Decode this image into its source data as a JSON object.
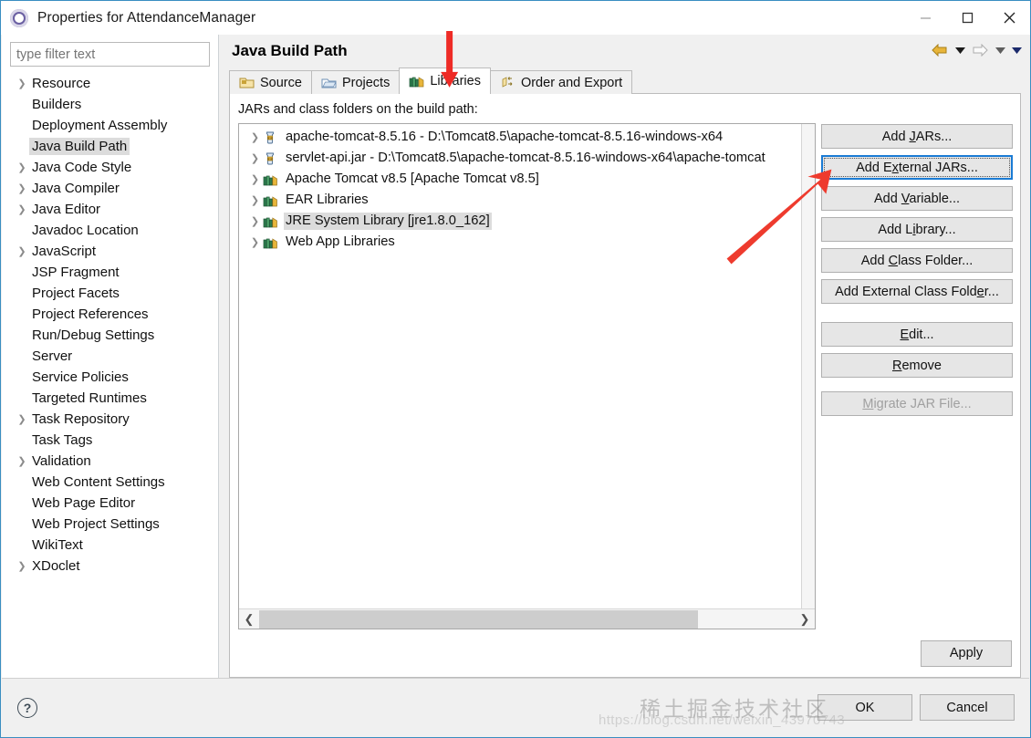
{
  "window": {
    "title": "Properties for AttendanceManager",
    "icon": "eclipse-properties-icon",
    "controls": {
      "minimize": "–",
      "maximize": "□",
      "close": "✕"
    }
  },
  "sidebar": {
    "filter": {
      "placeholder": "type filter text",
      "value": ""
    },
    "items": [
      {
        "label": "Resource",
        "expandable": true,
        "selected": false
      },
      {
        "label": "Builders",
        "expandable": false,
        "selected": false
      },
      {
        "label": "Deployment Assembly",
        "expandable": false,
        "selected": false
      },
      {
        "label": "Java Build Path",
        "expandable": false,
        "selected": true
      },
      {
        "label": "Java Code Style",
        "expandable": true,
        "selected": false
      },
      {
        "label": "Java Compiler",
        "expandable": true,
        "selected": false
      },
      {
        "label": "Java Editor",
        "expandable": true,
        "selected": false
      },
      {
        "label": "Javadoc Location",
        "expandable": false,
        "selected": false
      },
      {
        "label": "JavaScript",
        "expandable": true,
        "selected": false
      },
      {
        "label": "JSP Fragment",
        "expandable": false,
        "selected": false
      },
      {
        "label": "Project Facets",
        "expandable": false,
        "selected": false
      },
      {
        "label": "Project References",
        "expandable": false,
        "selected": false
      },
      {
        "label": "Run/Debug Settings",
        "expandable": false,
        "selected": false
      },
      {
        "label": "Server",
        "expandable": false,
        "selected": false
      },
      {
        "label": "Service Policies",
        "expandable": false,
        "selected": false
      },
      {
        "label": "Targeted Runtimes",
        "expandable": false,
        "selected": false
      },
      {
        "label": "Task Repository",
        "expandable": true,
        "selected": false
      },
      {
        "label": "Task Tags",
        "expandable": false,
        "selected": false
      },
      {
        "label": "Validation",
        "expandable": true,
        "selected": false
      },
      {
        "label": "Web Content Settings",
        "expandable": false,
        "selected": false
      },
      {
        "label": "Web Page Editor",
        "expandable": false,
        "selected": false
      },
      {
        "label": "Web Project Settings",
        "expandable": false,
        "selected": false
      },
      {
        "label": "WikiText",
        "expandable": false,
        "selected": false
      },
      {
        "label": "XDoclet",
        "expandable": true,
        "selected": false
      }
    ]
  },
  "page": {
    "title": "Java Build Path",
    "nav": {
      "back_icon": "back-arrow-icon",
      "back_menu_icon": "chevron-down-icon",
      "forward_icon": "forward-arrow-icon",
      "forward_menu_icon": "chevron-down-icon",
      "view_menu_icon": "chevron-down-icon"
    }
  },
  "tabs": [
    {
      "label": "Source",
      "icon": "source-folder-icon",
      "active": false
    },
    {
      "label": "Projects",
      "icon": "project-folder-icon",
      "active": false
    },
    {
      "label": "Libraries",
      "icon": "libraries-books-icon",
      "active": true
    },
    {
      "label": "Order and Export",
      "icon": "order-export-icon",
      "active": false
    }
  ],
  "libraries_tab": {
    "list_label": "JARs and class folders on the build path:",
    "entries": [
      {
        "label": "apache-tomcat-8.5.16 - D:\\Tomcat8.5\\apache-tomcat-8.5.16-windows-x64",
        "icon": "jar-icon",
        "selected": false
      },
      {
        "label": "servlet-api.jar - D:\\Tomcat8.5\\apache-tomcat-8.5.16-windows-x64\\apache-tomcat",
        "icon": "jar-icon",
        "selected": false
      },
      {
        "label": "Apache Tomcat v8.5 [Apache Tomcat v8.5]",
        "icon": "library-icon",
        "selected": false
      },
      {
        "label": "EAR Libraries",
        "icon": "library-icon",
        "selected": false
      },
      {
        "label": "JRE System Library [jre1.8.0_162]",
        "icon": "library-icon",
        "selected": true
      },
      {
        "label": "Web App Libraries",
        "icon": "library-icon",
        "selected": false
      }
    ],
    "buttons": [
      {
        "label": "Add JARs...",
        "state": "enabled",
        "focused": false
      },
      {
        "label": "Add External JARs...",
        "state": "enabled",
        "focused": true
      },
      {
        "label": "Add Variable...",
        "state": "enabled",
        "focused": false
      },
      {
        "label": "Add Library...",
        "state": "enabled",
        "focused": false
      },
      {
        "label": "Add Class Folder...",
        "state": "enabled",
        "focused": false
      },
      {
        "label": "Add External Class Folder...",
        "state": "enabled",
        "focused": false
      },
      {
        "label": "Edit...",
        "state": "enabled",
        "focused": false
      },
      {
        "label": "Remove",
        "state": "enabled",
        "focused": false
      },
      {
        "label": "Migrate JAR File...",
        "state": "disabled",
        "focused": false
      }
    ],
    "scrollbar": {
      "left_arrow_icon": "chevron-left-icon",
      "right_arrow_icon": "chevron-right-icon",
      "thumb_percent": 82
    }
  },
  "footer": {
    "apply_label": "Apply",
    "ok_label": "OK",
    "cancel_label": "Cancel",
    "help_icon": "help-question-icon"
  },
  "watermark": {
    "text_cn": "稀土掘金技术社区",
    "url": "https://blog.csdn.net/weixin_43970743"
  },
  "annotations": [
    {
      "name": "arrow-pointing-libraries-tab",
      "color": "#ee2b26"
    },
    {
      "name": "arrow-pointing-add-external-jars",
      "color": "#ee3b2e"
    }
  ],
  "colors": {
    "accent_blue": "#1a7bd4",
    "window_border": "#3a8ec1",
    "selection_gray": "#dcdcdc",
    "annotation_red": "#ee2b26"
  }
}
